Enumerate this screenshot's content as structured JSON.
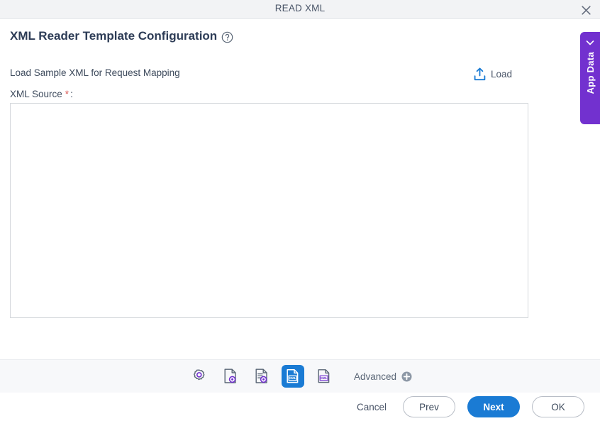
{
  "window": {
    "title": "READ XML",
    "close_icon": "close-icon"
  },
  "header": {
    "title": "XML Reader Template Configuration",
    "help_icon": "help-circle-icon"
  },
  "form": {
    "section_label": "Load Sample XML for Request Mapping",
    "load_button": {
      "label": "Load",
      "icon": "upload-icon"
    },
    "field": {
      "label": "XML Source",
      "required_marker": "*",
      "colon": ":",
      "value": "",
      "placeholder": ""
    }
  },
  "side_panel": {
    "label": "App Data",
    "collapse_icon": "chevron-left-icon",
    "color": "#7231cf"
  },
  "toolbar": {
    "items": [
      {
        "name": "gear-icon",
        "label": "",
        "active": false
      },
      {
        "name": "document-gear-icon",
        "label": "",
        "active": false
      },
      {
        "name": "document-lines-gear-icon",
        "label": "",
        "active": false
      },
      {
        "name": "xml-document-icon",
        "label": "",
        "active": true
      },
      {
        "name": "xml-document-outline-icon",
        "label": "",
        "active": false
      }
    ],
    "advanced": {
      "label": "Advanced",
      "icon": "circle-plus-icon"
    },
    "active_color": "#1a7bd4",
    "icon_accent_color": "#7231cf"
  },
  "footer": {
    "cancel_label": "Cancel",
    "prev_label": "Prev",
    "next_label": "Next",
    "ok_label": "OK",
    "primary_color": "#1a7bd4"
  }
}
